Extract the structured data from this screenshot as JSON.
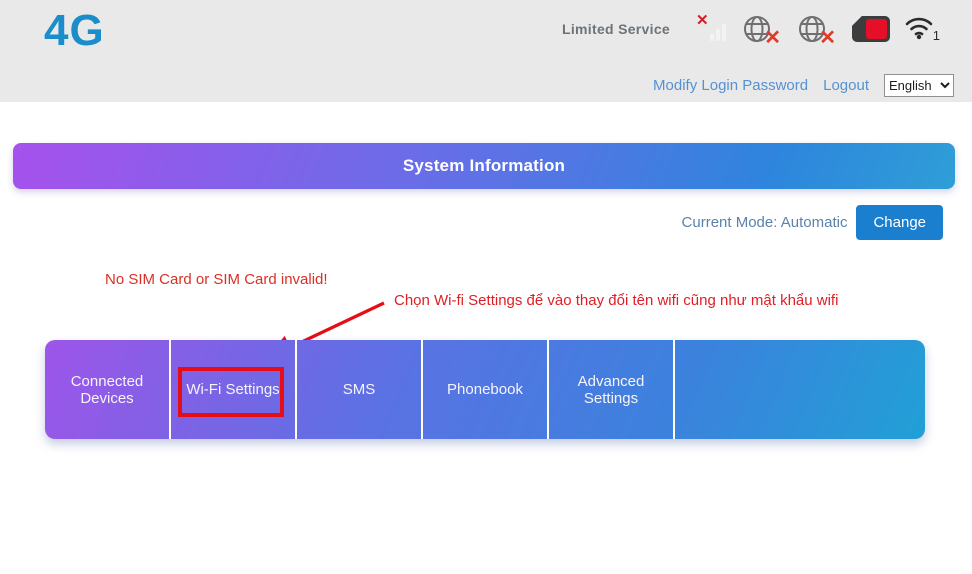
{
  "header": {
    "logo": "4G",
    "status_text": "Limited Service",
    "wifi_count": "1",
    "icons": [
      "signal-bars-error-icon",
      "globe-error-icon",
      "globe-error-icon",
      "sim-card-error-icon",
      "wifi-icon"
    ],
    "links": {
      "modify_password": "Modify Login Password",
      "logout": "Logout"
    },
    "language": {
      "selected": "English"
    }
  },
  "banner": {
    "title": "System Information"
  },
  "mode": {
    "label": "Current Mode: Automatic",
    "change_button": "Change"
  },
  "alerts": {
    "sim_warning": "No SIM Card or SIM Card invalid!",
    "annotation": "Chọn Wi-fi Settings để vào thay đổi tên wifi cũng như mật khẩu wifi"
  },
  "nav": {
    "tabs": [
      {
        "label": "Connected Devices"
      },
      {
        "label": "Wi-Fi Settings",
        "highlighted": true
      },
      {
        "label": "SMS"
      },
      {
        "label": "Phonebook"
      },
      {
        "label": "Advanced Settings"
      }
    ]
  },
  "colors": {
    "header_bg": "#e9e9e9",
    "logo_blue": "#1b8dcb",
    "link_blue": "#5592d2",
    "banner_gradient_start": "#a751ec",
    "banner_gradient_end": "#2f9ed7",
    "button_blue": "#1b7fd0",
    "mode_text": "#5b82ab",
    "alert_red": "#d93025",
    "highlight_red": "#e60d17",
    "sim_status_red": "#e60f28"
  }
}
